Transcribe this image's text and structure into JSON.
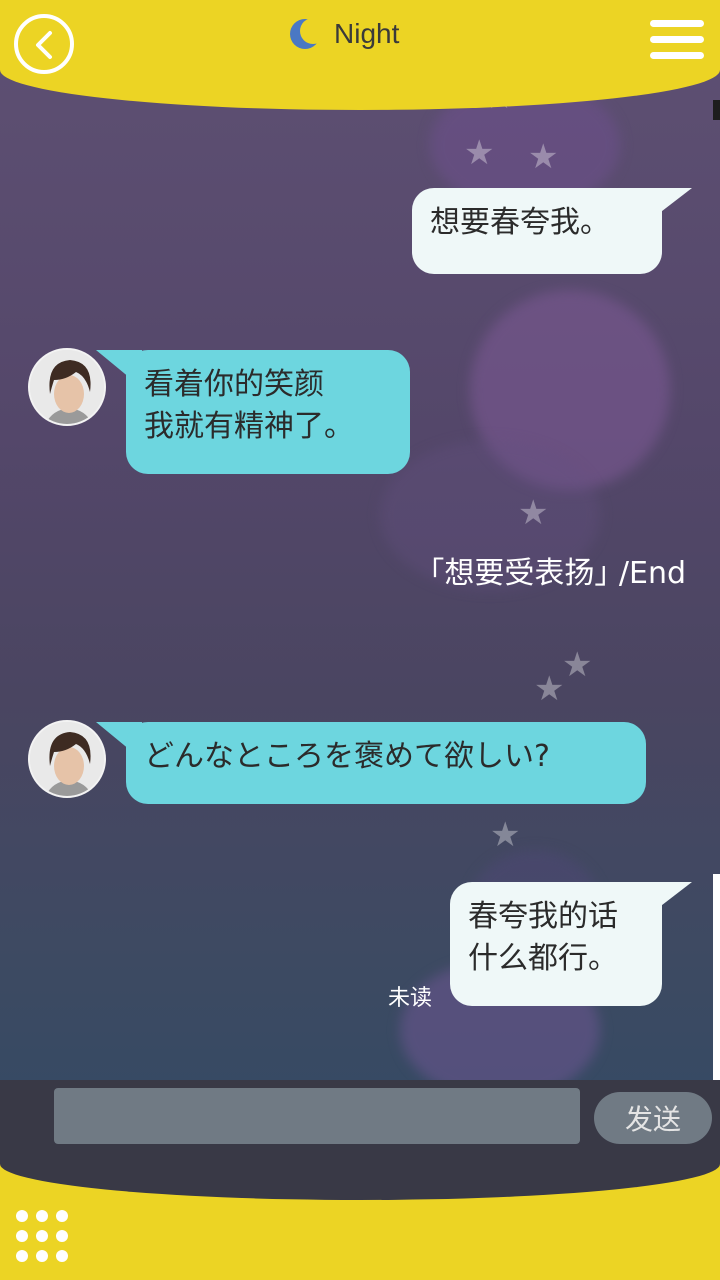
{
  "header": {
    "title": "Night",
    "back_icon": "chevron-left-icon",
    "menu_icon": "hamburger-menu-icon",
    "title_icon": "moon-icon"
  },
  "colors": {
    "header_bg": "#ecd424",
    "npc_bubble": "#6dd6df",
    "player_bubble": "#eff8f8",
    "input_bar": "#393946"
  },
  "messages": [
    {
      "sender": "player",
      "text": "想要春夸我。"
    },
    {
      "sender": "npc",
      "line1": "看着你的笑颜",
      "line2": "我就有精神了。"
    },
    {
      "sender": "npc",
      "text": "どんなところを褒めて欲しい?"
    },
    {
      "sender": "player",
      "line1": "春夸我的话",
      "line2": "什么都行。",
      "status": "未读"
    }
  ],
  "system_text": "｢想要受表扬｣ /End",
  "input": {
    "value": "",
    "placeholder": ""
  },
  "send_label": "发送",
  "grid_icon": "dots-grid-icon"
}
